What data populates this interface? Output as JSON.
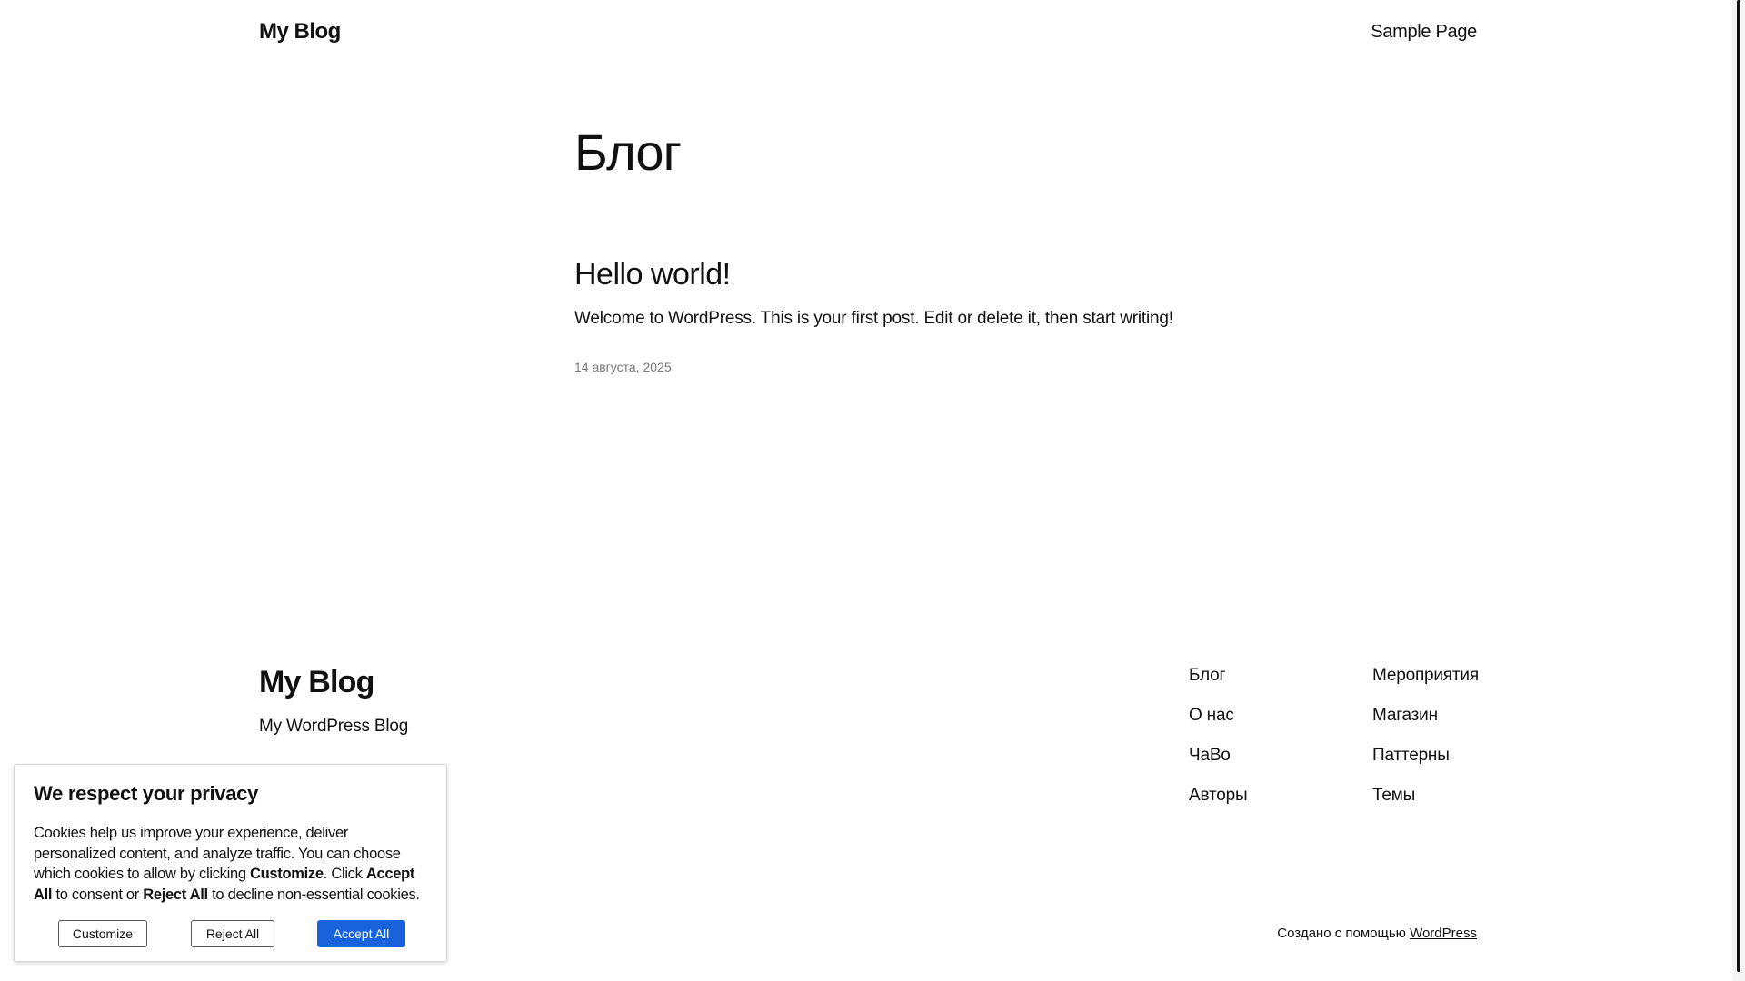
{
  "header": {
    "site_title": "My Blog",
    "nav_items": [
      "Sample Page"
    ]
  },
  "main": {
    "page_heading": "Блог",
    "posts": [
      {
        "title": "Hello world!",
        "excerpt": "Welcome to WordPress. This is your first post. Edit or delete it, then start writing!",
        "date": "14 августа, 2025"
      }
    ]
  },
  "footer": {
    "site_title": "My Blog",
    "tagline": "My WordPress Blog",
    "nav_col_a": [
      "Блог",
      "О нас",
      "ЧаВо",
      "Авторы"
    ],
    "nav_col_b": [
      "Мероприятия",
      "Магазин",
      "Паттерны",
      "Темы"
    ],
    "credits_prefix": "Создано с помощью",
    "credits_link": "WordPress"
  },
  "cookie_banner": {
    "title": "We respect your privacy",
    "text_part1": "Cookies help us improve your experience, deliver personalized content, and analyze traffic. You can choose which cookies to allow by clicking ",
    "text_bold1": "Customize",
    "text_part2": ". Click ",
    "text_bold2": "Accept All",
    "text_part3": " to consent or ",
    "text_bold3": "Reject All",
    "text_part4": " to decline non-essential cookies.",
    "customize_label": "Customize",
    "reject_label": "Reject All",
    "accept_label": "Accept All",
    "accent_color": "#1863dc"
  }
}
